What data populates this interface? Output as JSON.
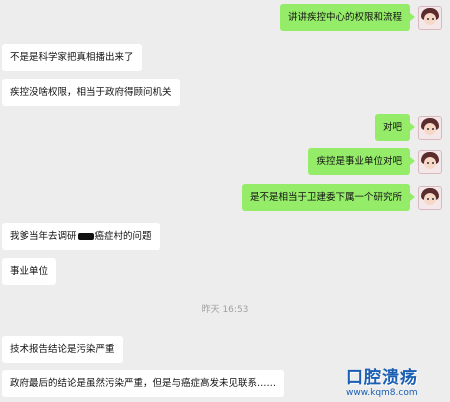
{
  "messages": [
    {
      "side": "out",
      "text": "讲讲疾控中心的权限和流程"
    },
    {
      "side": "in",
      "text": "不是是科学家把真相播出来了"
    },
    {
      "side": "in",
      "text": "疾控没啥权限，相当于政府得顾问机关"
    },
    {
      "side": "out",
      "text": "对吧"
    },
    {
      "side": "out",
      "text": "疾控是事业单位对吧"
    },
    {
      "side": "out",
      "text": "是不是相当于卫建委下属一个研究所"
    },
    {
      "side": "in",
      "text_before": "我爹当年去调研",
      "text_after": "癌症村的问题"
    },
    {
      "side": "in",
      "text": "事业单位"
    },
    {
      "side": "in",
      "text": "技术报告结论是污染严重"
    },
    {
      "side": "in",
      "text": "政府最后的结论是虽然污染严重，但是与癌症高发未见联系……"
    }
  ],
  "timestamp": "昨天 16:53",
  "watermark": {
    "title": "口腔溃疡",
    "url": "www.kqm8.com"
  }
}
